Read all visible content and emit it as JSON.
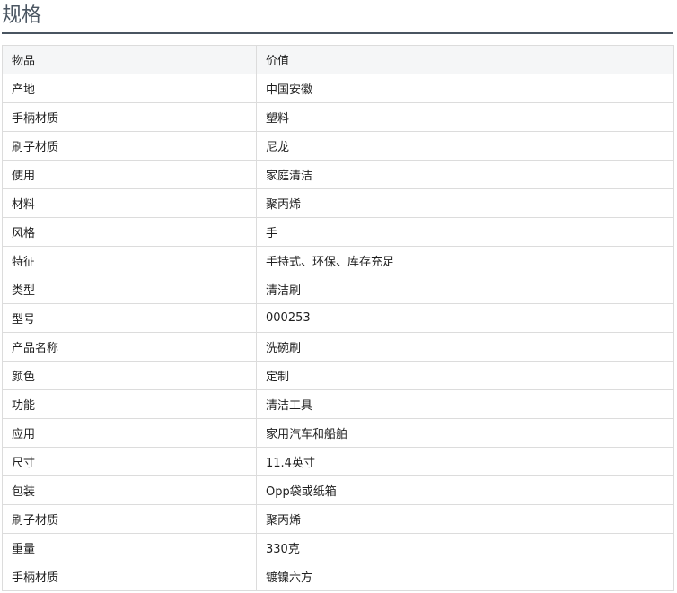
{
  "section": {
    "title": "规格"
  },
  "table": {
    "headers": [
      "物品",
      "价值"
    ],
    "rows": [
      {
        "item": "产地",
        "value": "中国安徽"
      },
      {
        "item": "手柄材质",
        "value": "塑料"
      },
      {
        "item": "刷子材质",
        "value": "尼龙"
      },
      {
        "item": "使用",
        "value": "家庭清洁"
      },
      {
        "item": "材料",
        "value": "聚丙烯"
      },
      {
        "item": "风格",
        "value": "手"
      },
      {
        "item": "特征",
        "value": "手持式、环保、库存充足"
      },
      {
        "item": "类型",
        "value": "清洁刷"
      },
      {
        "item": "型号",
        "value": "000253"
      },
      {
        "item": "产品名称",
        "value": "洗碗刷"
      },
      {
        "item": "颜色",
        "value": "定制"
      },
      {
        "item": "功能",
        "value": "清洁工具"
      },
      {
        "item": "应用",
        "value": "家用汽车和船舶"
      },
      {
        "item": "尺寸",
        "value": "11.4英寸"
      },
      {
        "item": "包装",
        "value": "Opp袋或纸箱"
      },
      {
        "item": "刷子材质",
        "value": "聚丙烯"
      },
      {
        "item": "重量",
        "value": "330克"
      },
      {
        "item": "手柄材质",
        "value": "镀镍六方"
      }
    ]
  }
}
